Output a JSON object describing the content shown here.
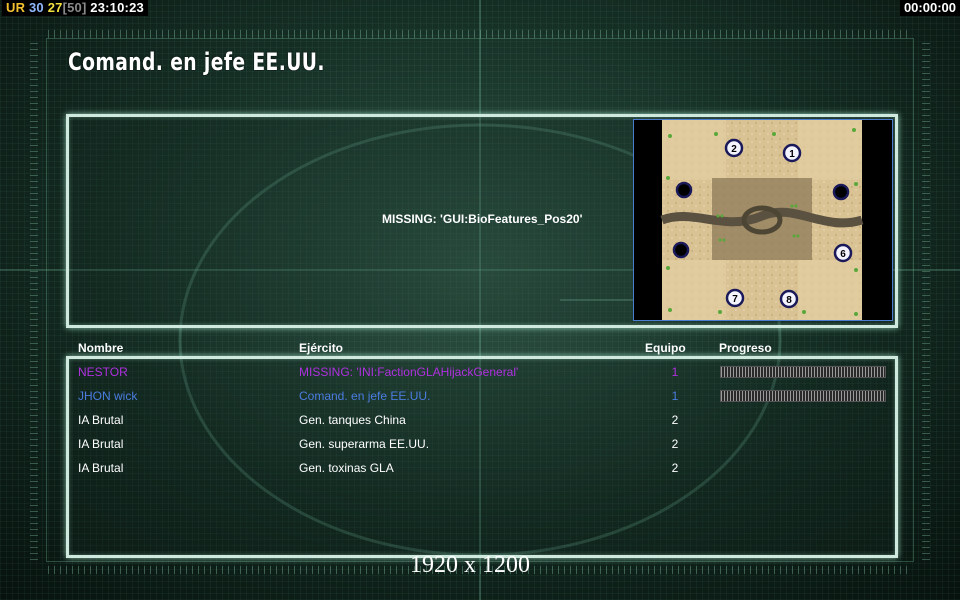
{
  "hud": {
    "prefix": "UR",
    "value_a": "30",
    "value_b": "27",
    "bracket_value": "[50]",
    "clock": "23:10:23",
    "timer": "00:00:00"
  },
  "title": "Comand. en jefe EE.UU.",
  "missing_text": "MISSING: 'GUI:BioFeatures_Pos20'",
  "map": {
    "start_positions": [
      "1",
      "2",
      "6",
      "7",
      "8"
    ]
  },
  "columns": {
    "name": "Nombre",
    "army": "Ejército",
    "team": "Equipo",
    "progress": "Progreso"
  },
  "players": [
    {
      "name": "NESTOR",
      "army": "MISSING: 'INI:FactionGLAHijackGeneral'",
      "team": "1",
      "color": "#b030e0",
      "progress": 1.0
    },
    {
      "name": "JHON wick",
      "army": "Comand. en jefe EE.UU.",
      "team": "1",
      "color": "#4a7ce0",
      "progress": 1.0
    },
    {
      "name": "IA Brutal",
      "army": "Gen. tanques China",
      "team": "2",
      "color": "#ffffff"
    },
    {
      "name": "IA Brutal",
      "army": "Gen. superarma EE.UU.",
      "team": "2",
      "color": "#ffffff"
    },
    {
      "name": "IA Brutal",
      "army": "Gen. toxinas GLA",
      "team": "2",
      "color": "#ffffff"
    }
  ],
  "resolution": "1920 x 1200",
  "colors": {
    "hud_prefix": "#f2c230",
    "hud_value_a": "#8fb8ff",
    "hud_value_b": "#f2e040",
    "hud_bracket": "#8a8a8a"
  }
}
